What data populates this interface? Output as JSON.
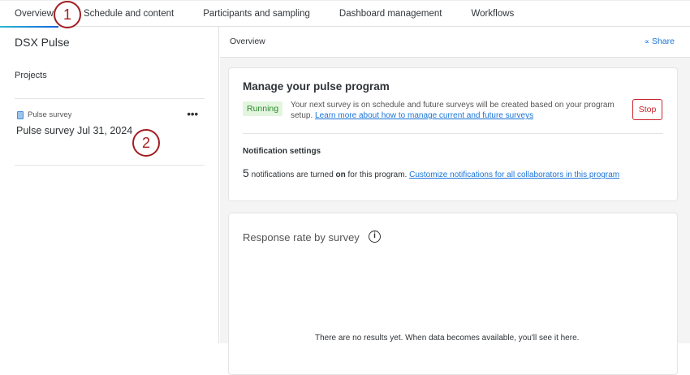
{
  "tabs": [
    {
      "label": "Overview",
      "active": true
    },
    {
      "label": "Schedule and content"
    },
    {
      "label": "Participants and sampling"
    },
    {
      "label": "Dashboard management"
    },
    {
      "label": "Workflows"
    }
  ],
  "sidebar": {
    "title": "DSX Pulse",
    "section": "Projects",
    "project": {
      "type": "Pulse survey",
      "name": "Pulse survey Jul 31, 2024"
    }
  },
  "header": {
    "title": "Overview",
    "share": "Share"
  },
  "manage": {
    "title": "Manage your pulse program",
    "status": "Running",
    "text": "Your next survey is on schedule and future surveys will be created based on your program setup.",
    "link": "Learn more about how to manage current and future surveys",
    "stop": "Stop",
    "notif_title": "Notification settings",
    "notif_count": "5",
    "notif_text1": "notifications are turned",
    "notif_on": "on",
    "notif_text2": "for this program.",
    "notif_link": "Customize notifications for all collaborators in this program"
  },
  "response": {
    "title": "Response rate by survey",
    "empty": "There are no results yet. When data becomes available, you'll see it here."
  },
  "callouts": [
    "1",
    "2"
  ],
  "colors": {
    "accent": "#1a73d8",
    "running_bg": "#e3f5df",
    "running_fg": "#2e8a2e",
    "stop": "#c8242b"
  }
}
